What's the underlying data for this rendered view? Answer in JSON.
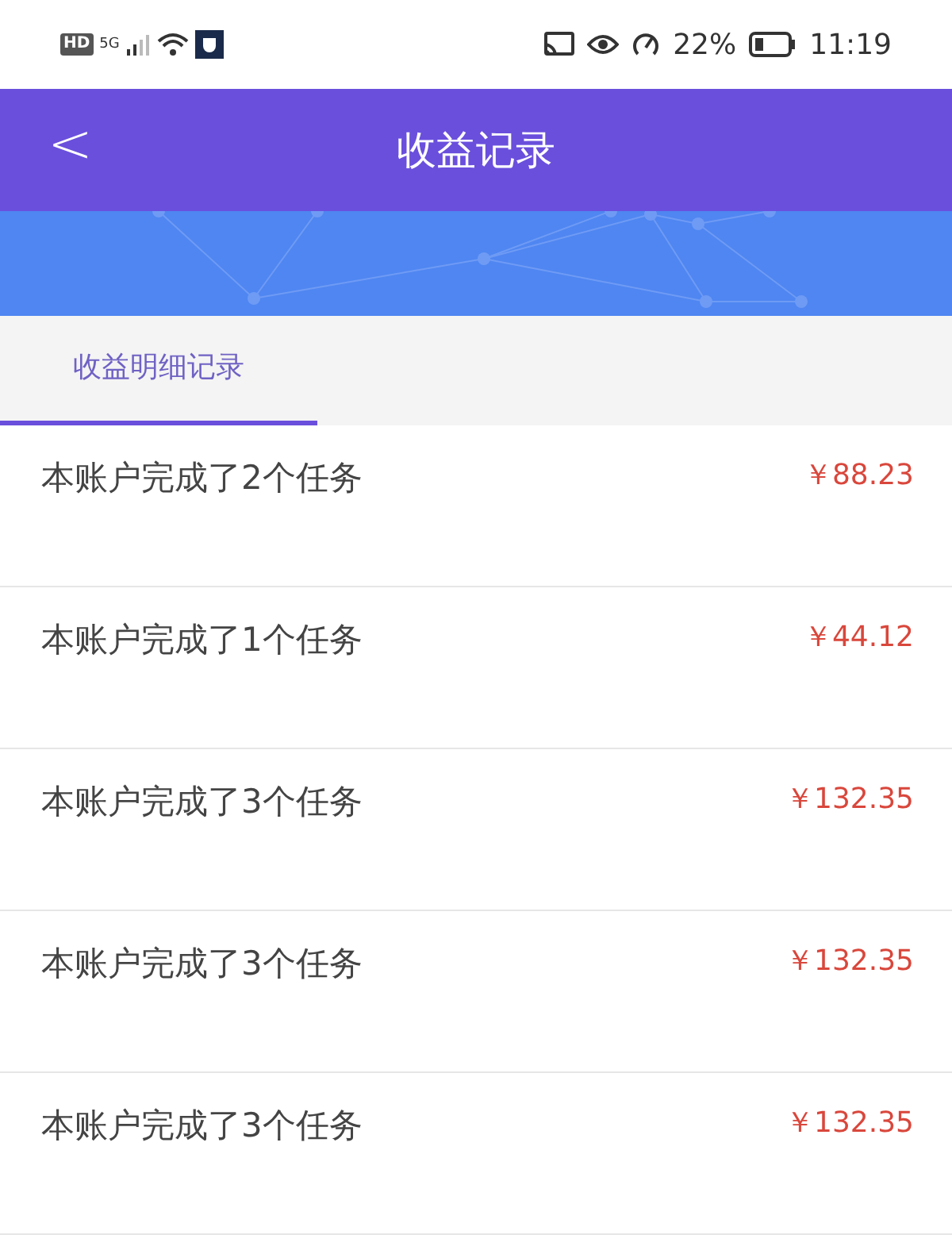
{
  "status_bar": {
    "left_badges": [
      "HD",
      "5G"
    ],
    "battery": "22%",
    "time": "11:19"
  },
  "header": {
    "back": "<",
    "title": "收益记录"
  },
  "tabs": [
    {
      "label": "收益明细记录",
      "selected": true
    }
  ],
  "records": [
    {
      "text": "本账户完成了2个任务",
      "amount": "￥88.23"
    },
    {
      "text": "本账户完成了1个任务",
      "amount": "￥44.12"
    },
    {
      "text": "本账户完成了3个任务",
      "amount": "￥132.35"
    },
    {
      "text": "本账户完成了3个任务",
      "amount": "￥132.35"
    },
    {
      "text": "本账户完成了3个任务",
      "amount": "￥132.35"
    }
  ]
}
